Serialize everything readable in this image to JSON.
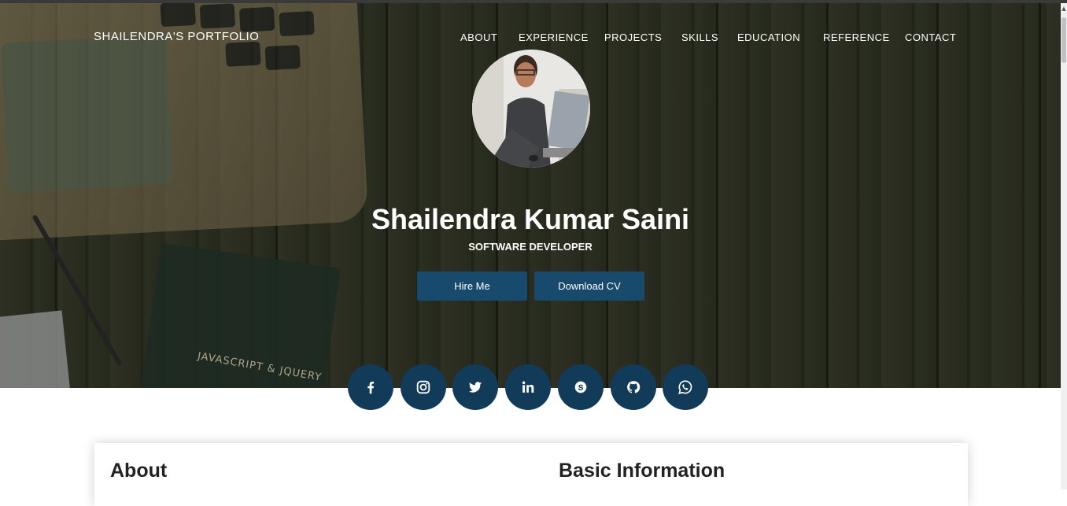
{
  "header": {
    "brand": "SHAILENDRA'S PORTFOLIO",
    "nav": [
      "ABOUT",
      "EXPERIENCE",
      "PROJECTS",
      "SKILLS",
      "EDUCATION",
      "REFERENCE",
      "CONTACT"
    ]
  },
  "hero": {
    "name": "Shailendra Kumar Saini",
    "role": "SOFTWARE DEVELOPER",
    "hire_label": "Hire Me",
    "cv_label": "Download CV",
    "book_text": "JAVASCRIPT & JQUERY"
  },
  "social": [
    "facebook-icon",
    "instagram-icon",
    "twitter-icon",
    "linkedin-icon",
    "skype-icon",
    "github-icon",
    "whatsapp-icon"
  ],
  "sections": {
    "about_title": "About",
    "basic_info_title": "Basic Information"
  },
  "colors": {
    "accent": "#174a6d",
    "social_bg": "#113b59"
  }
}
